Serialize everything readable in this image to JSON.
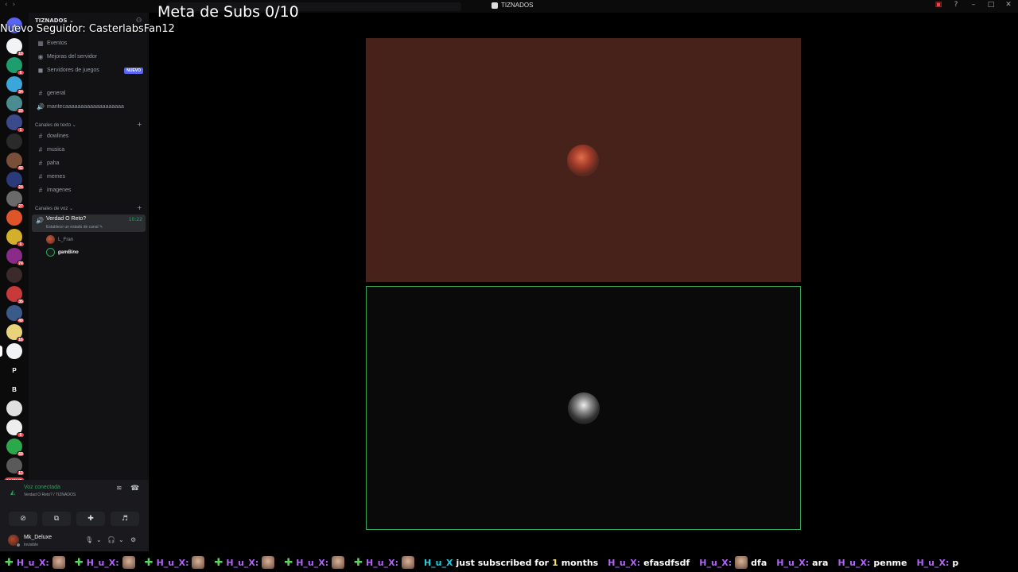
{
  "window": {
    "title": "TIZNADOS"
  },
  "server": {
    "name": "TIZNADOS ⌄"
  },
  "rail": {
    "servers": [
      {
        "color": "#f2f3f5",
        "badge": "10",
        "label": ""
      },
      {
        "color": "#1e9e6e",
        "badge": "6",
        "label": ""
      },
      {
        "color": "#3aa6d9",
        "badge": "34",
        "label": ""
      },
      {
        "color": "#4a8c8f",
        "badge": "20",
        "label": ""
      },
      {
        "color": "#3a4a8a",
        "badge": "1",
        "label": ""
      },
      {
        "color": "#2a2a2a",
        "badge": "",
        "label": ""
      },
      {
        "color": "#7a4f3a",
        "badge": "42",
        "label": ""
      },
      {
        "color": "#2b3a7a",
        "badge": "24",
        "label": ""
      },
      {
        "color": "#6a6a6a",
        "badge": "27",
        "label": ""
      },
      {
        "color": "#e0542a",
        "badge": "",
        "label": ""
      },
      {
        "color": "#d4b02a",
        "badge": "6",
        "label": ""
      },
      {
        "color": "#8a2a8a",
        "badge": "74",
        "label": ""
      },
      {
        "color": "#3a2a2a",
        "badge": "",
        "label": ""
      },
      {
        "color": "#c83a3a",
        "badge": "35",
        "label": ""
      },
      {
        "color": "#3a5a8a",
        "badge": "49",
        "label": ""
      },
      {
        "color": "#e8d27a",
        "badge": "16",
        "label": ""
      },
      {
        "color": "#f2f3f5",
        "badge": "",
        "label": ""
      },
      {
        "color": "#0b0b0c",
        "badge": "",
        "label": "P"
      },
      {
        "color": "#0b0b0c",
        "badge": "",
        "label": "B"
      },
      {
        "color": "#e0e0e0",
        "badge": "",
        "label": ""
      },
      {
        "color": "#eeeeee",
        "badge": "6",
        "label": ""
      },
      {
        "color": "#2aa84a",
        "badge": "69",
        "label": ""
      },
      {
        "color": "#5a5a5a",
        "badge": "13",
        "label": ""
      }
    ],
    "new_label": "NUEVO"
  },
  "sidebar": {
    "top_items": [
      {
        "icon": "▦",
        "label": "Eventos"
      },
      {
        "icon": "◉",
        "label": "Mejoras del servidor"
      },
      {
        "icon": "◼",
        "label": "Servidores de juegos",
        "badge": "NUEVO"
      }
    ],
    "loose_channels": [
      {
        "icon": "#",
        "label": "general"
      },
      {
        "icon": "🔊",
        "label": "mantecaaaaaaaaaaaaaaaaaaa"
      }
    ],
    "text_category": "Canales de texto ⌄",
    "text_channels": [
      {
        "icon": "#",
        "label": "dowlines"
      },
      {
        "icon": "#",
        "label": "musica"
      },
      {
        "icon": "#",
        "label": "paha"
      },
      {
        "icon": "#",
        "label": "memes"
      },
      {
        "icon": "#",
        "label": "imagenes"
      }
    ],
    "voice_category": "Canales de voz ⌄",
    "voice_channel": {
      "name": "Verdad O Reto?",
      "status": "Establece un estado de canal ✎",
      "time": "10:22"
    },
    "voice_users": [
      {
        "name": "L_Fran"
      },
      {
        "name": "gamBino"
      }
    ]
  },
  "voice_panel": {
    "title": "Voz conectada",
    "subtitle": "Verdad O Reto? / TIZNADOS"
  },
  "user": {
    "name": "Mk_Deluxe",
    "status": "Invisible"
  },
  "overlay": {
    "meta": "Meta de Subs 0/10",
    "follower": "Nuevo Seguidor: CasterlabsFan12"
  },
  "ticker": {
    "user": "H_u_X:",
    "sub_user": "H_u_X",
    "sub_text_a": "just subscribed for",
    "sub_months": "1",
    "sub_text_b": "months",
    "messages": [
      {
        "user": "H_u_X:",
        "text": "efasdfsdf"
      },
      {
        "user": "H_u_X:",
        "text": "dfa"
      },
      {
        "user": "H_u_X:",
        "text": "ara"
      },
      {
        "user": "H_u_X:",
        "text": "penme"
      },
      {
        "user": "H_u_X:",
        "text": "p"
      }
    ]
  },
  "colors": {
    "accent_green": "#23a55a",
    "ticker_name": "#b362ff",
    "tile_top_bg": "#46221a",
    "tile_border": "#3ba55c"
  }
}
